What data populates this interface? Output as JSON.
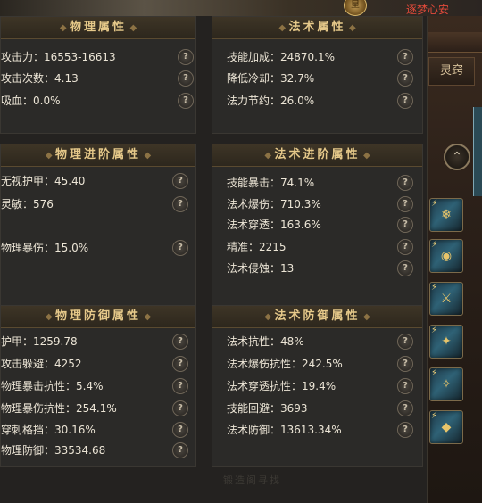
{
  "top": {
    "player_name": "逐梦心安",
    "emblem": "皇"
  },
  "side": {
    "tab_label": "灵窍",
    "circle_button": "⌃",
    "skill_slots": [
      {
        "corner": "⚡",
        "icon": "ice-blade-icon"
      },
      {
        "corner": "⚡",
        "icon": "orb-icon"
      },
      {
        "corner": "⚡",
        "icon": "sword-icon"
      },
      {
        "corner": "⚡",
        "icon": "dragon-icon"
      },
      {
        "corner": "⚡",
        "icon": "blade-icon"
      },
      {
        "corner": "⚡",
        "icon": "gem-icon"
      }
    ]
  },
  "help_glyph": "?",
  "physical_attrs": {
    "title": "物理属性",
    "rows": [
      {
        "label": "攻击力：16553-16613"
      },
      {
        "label": "攻击次数：4.13"
      },
      {
        "label": "吸血：0.0%"
      }
    ]
  },
  "magic_attrs": {
    "title": "法术属性",
    "rows": [
      {
        "label": "技能加成：24870.1%"
      },
      {
        "label": "降低冷却：32.7%"
      },
      {
        "label": "法力节约：26.0%"
      }
    ]
  },
  "physical_advanced": {
    "title": "物理进阶属性",
    "rows": [
      {
        "label": "无视护甲：45.40"
      },
      {
        "label": "灵敏：576"
      },
      {
        "label": "物理暴伤：15.0%"
      }
    ]
  },
  "magic_advanced": {
    "title": "法术进阶属性",
    "rows": [
      {
        "label": "技能暴击：74.1%"
      },
      {
        "label": "法术爆伤：710.3%"
      },
      {
        "label": "法术穿透：163.6%"
      },
      {
        "label": "精准：2215"
      },
      {
        "label": "法术侵蚀：13"
      }
    ]
  },
  "physical_defense": {
    "title": "物理防御属性",
    "rows": [
      {
        "label": "护甲：1259.78"
      },
      {
        "label": "攻击躲避：4252"
      },
      {
        "label": "物理暴击抗性：5.4%"
      },
      {
        "label": "物理暴伤抗性：254.1%"
      },
      {
        "label": "穿刺格挡：30.16%"
      },
      {
        "label": "物理防御：33534.68"
      }
    ]
  },
  "magic_defense": {
    "title": "法术防御属性",
    "rows": [
      {
        "label": "法术抗性：48%"
      },
      {
        "label": "法术爆伤抗性：242.5%"
      },
      {
        "label": "法术穿透抗性：19.4%"
      },
      {
        "label": "技能回避：3693"
      },
      {
        "label": "法术防御：13613.34%"
      }
    ]
  },
  "watermark": "锻造阁寻找"
}
